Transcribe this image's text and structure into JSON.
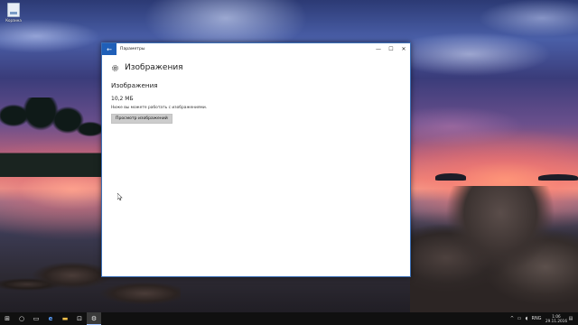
{
  "desktop": {
    "icon_label": "Корзина"
  },
  "window": {
    "title": "Параметры",
    "back_glyph": "←",
    "minimize_glyph": "—",
    "maximize_glyph": "☐",
    "close_glyph": "✕"
  },
  "page": {
    "title": "Изображения",
    "section_title": "Изображения",
    "size_value": "10,2 МБ",
    "description": "Ниже вы можете работать с изображениями.",
    "view_button_label": "Просмотр изображений"
  },
  "taskbar": {
    "start_glyph": "⊞",
    "search_glyph": "○",
    "taskview_glyph": "▭",
    "edge_glyph": "e",
    "explorer_glyph": "▬",
    "store_glyph": "⊡",
    "settings_glyph": "⚙",
    "language": "RNG",
    "time": "1:06",
    "date": "29.11.2016"
  },
  "colors": {
    "accent": "#1f5fb8",
    "button_bg": "#cccccc",
    "taskbar_bg": "#101010"
  },
  "icons": {
    "settings_page_icon": "gear-icon",
    "desktop_icon": "recycle-bin-icon"
  }
}
